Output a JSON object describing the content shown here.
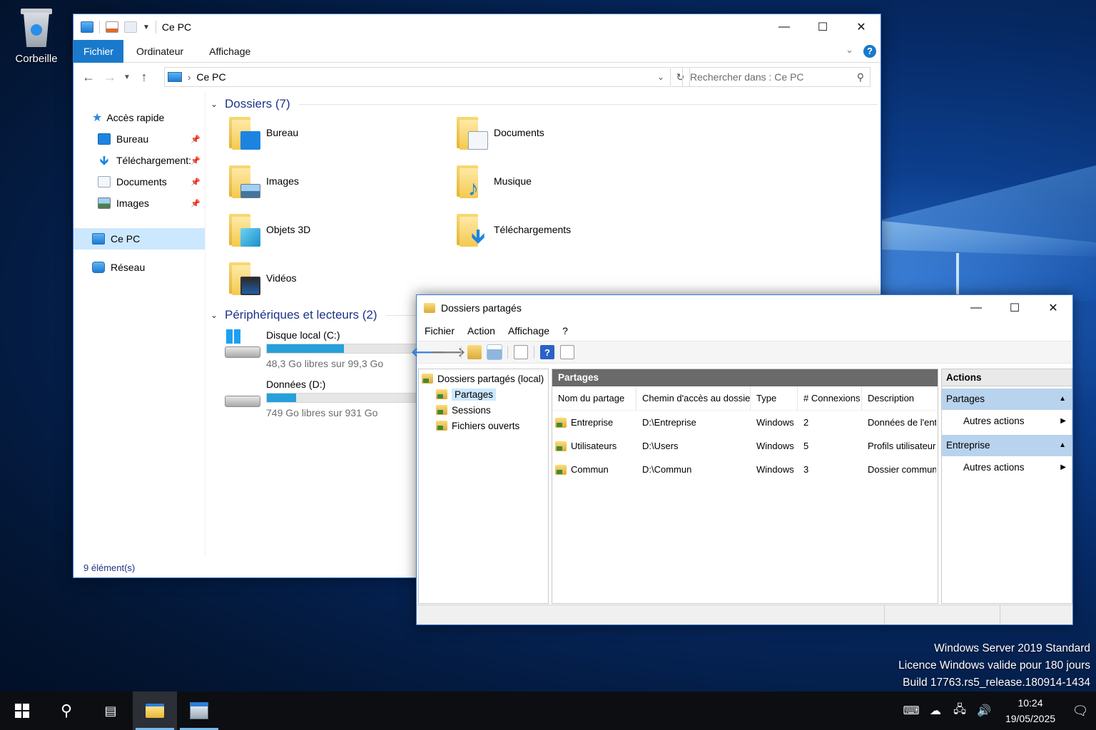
{
  "desktop": {
    "recycle_bin_label": "Corbeille",
    "watermark": [
      "Windows Server 2019 Standard",
      "Licence Windows valide pour 180 jours",
      "Build 17763.rs5_release.180914-1434"
    ]
  },
  "explorer": {
    "title": "Ce PC",
    "ribbon_tabs": [
      "Fichier",
      "Ordinateur",
      "Affichage"
    ],
    "help_glyph": "?",
    "address": "Ce PC",
    "search_placeholder": "Rechercher dans : Ce PC",
    "nav": {
      "quick_access": "Accès rapide",
      "pinned": [
        "Bureau",
        "Téléchargement:",
        "Documents",
        "Images"
      ],
      "this_pc": "Ce PC",
      "network": "Réseau"
    },
    "folders_header": "Dossiers (7)",
    "folders": [
      "Bureau",
      "Documents",
      "Images",
      "Musique",
      "Objets 3D",
      "Téléchargements",
      "Vidéos"
    ],
    "devices_header": "Périphériques et lecteurs (2)",
    "drives": [
      {
        "name": "Disque local (C:)",
        "free_text": "48,3 Go libres sur 99,3 Go",
        "used_fraction": 0.514
      },
      {
        "name": "Données (D:)",
        "free_text": "749 Go libres sur 931 Go",
        "used_fraction": 0.196
      }
    ],
    "status": "9 élément(s)"
  },
  "mmc": {
    "title": "Dossiers partagés",
    "menu": [
      "Fichier",
      "Action",
      "Affichage",
      "?"
    ],
    "tree": {
      "root": "Dossiers partagés (local)",
      "children": [
        "Partages",
        "Sessions",
        "Fichiers ouverts"
      ]
    },
    "list_title": "Partages",
    "columns": [
      "Nom du partage",
      "Chemin d'accès au dossier",
      "Type",
      "# Connexions",
      "Description"
    ],
    "rows": [
      [
        "Entreprise",
        "D:\\Entreprise",
        "Windows",
        "2",
        "Données de l'entreprise"
      ],
      [
        "Utilisateurs",
        "D:\\Users",
        "Windows",
        "5",
        "Profils utilisateurs"
      ],
      [
        "Commun",
        "D:\\Commun",
        "Windows",
        "3",
        "Dossier commun"
      ]
    ],
    "actions": {
      "header": "Actions",
      "sections": [
        {
          "title": "Partages",
          "item": "Autres actions"
        },
        {
          "title": "Entreprise",
          "item": "Autres actions"
        }
      ]
    }
  },
  "taskbar": {
    "time": "10:24",
    "date": "19/05/2025"
  },
  "colors": {
    "accent": "#1979ca",
    "progress": "#26a0da",
    "selection": "#cce8ff",
    "list_header": "#6a6a6a",
    "action_section": "#b8d3ed"
  }
}
